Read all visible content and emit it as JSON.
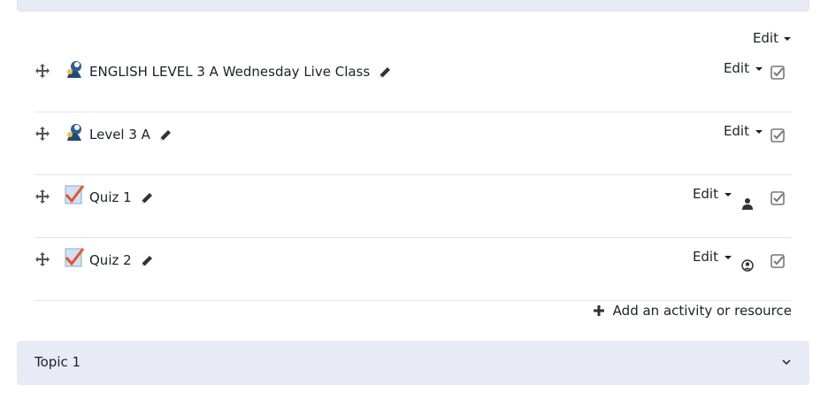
{
  "section": {
    "edit_label": "Edit"
  },
  "activities": [
    {
      "name": "ENGLISH LEVEL 3 A Wednesday Live Class",
      "type": "live-class",
      "edit_label": "Edit",
      "restriction_icon": null
    },
    {
      "name": "Level 3 A",
      "type": "live-class",
      "edit_label": "Edit",
      "restriction_icon": null
    },
    {
      "name": "Quiz 1",
      "type": "quiz",
      "edit_label": "Edit",
      "restriction_icon": "person-icon"
    },
    {
      "name": "Quiz 2",
      "type": "quiz",
      "edit_label": "Edit",
      "restriction_icon": "user-circle-icon"
    }
  ],
  "add_activity": {
    "label": "Add an activity or resource"
  },
  "next_section": {
    "title": "Topic 1"
  },
  "colors": {
    "section_bg": "#e8ebf5",
    "quiz_check": "#e8542a",
    "divider": "#e3e4e6"
  }
}
